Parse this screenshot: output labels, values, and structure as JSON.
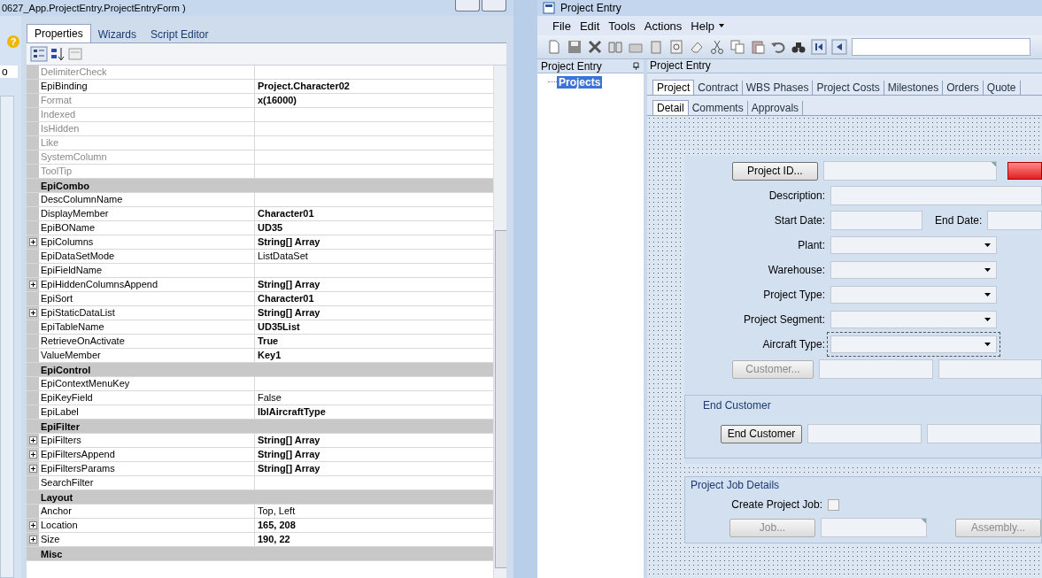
{
  "left_window": {
    "title": "0627_App.ProjectEntry.ProjectEntryForm )",
    "help_glyph": "?",
    "side_label": "o",
    "tabs": [
      {
        "label": "Properties",
        "selected": true
      },
      {
        "label": "Wizards",
        "selected": false
      },
      {
        "label": "Script Editor",
        "selected": false
      }
    ],
    "properties": [
      {
        "kind": "prop",
        "name": "DelimiterCheck",
        "disabled": true,
        "expandable": false
      },
      {
        "kind": "prop",
        "name": "EpiBinding",
        "value": "Project.Character02",
        "disabled": false,
        "bold": true,
        "expandable": false
      },
      {
        "kind": "prop",
        "name": "Format",
        "value": "x(16000)",
        "disabled": true,
        "bold": true,
        "expandable": false
      },
      {
        "kind": "prop",
        "name": "Indexed",
        "disabled": true,
        "expandable": false
      },
      {
        "kind": "prop",
        "name": "IsHidden",
        "disabled": true,
        "expandable": false
      },
      {
        "kind": "prop",
        "name": "Like",
        "disabled": true,
        "expandable": false
      },
      {
        "kind": "prop",
        "name": "SystemColumn",
        "disabled": true,
        "expandable": false
      },
      {
        "kind": "prop",
        "name": "ToolTip",
        "disabled": true,
        "expandable": false
      },
      {
        "kind": "category",
        "name": "EpiCombo"
      },
      {
        "kind": "prop",
        "name": "DescColumnName",
        "disabled": false,
        "expandable": false
      },
      {
        "kind": "prop",
        "name": "DisplayMember",
        "value": "Character01",
        "disabled": false,
        "bold": true,
        "expandable": false
      },
      {
        "kind": "prop",
        "name": "EpiBOName",
        "value": "UD35",
        "disabled": false,
        "bold": true,
        "expandable": false
      },
      {
        "kind": "prop",
        "name": "EpiColumns",
        "value": "String[] Array",
        "disabled": false,
        "bold": true,
        "expandable": true
      },
      {
        "kind": "prop",
        "name": "EpiDataSetMode",
        "value": "ListDataSet",
        "disabled": false,
        "bold": false,
        "expandable": false
      },
      {
        "kind": "prop",
        "name": "EpiFieldName",
        "disabled": false,
        "expandable": false
      },
      {
        "kind": "prop",
        "name": "EpiHiddenColumnsAppend",
        "value": "String[] Array",
        "disabled": false,
        "bold": true,
        "expandable": true
      },
      {
        "kind": "prop",
        "name": "EpiSort",
        "value": "Character01",
        "disabled": false,
        "bold": true,
        "expandable": false
      },
      {
        "kind": "prop",
        "name": "EpiStaticDataList",
        "value": "String[] Array",
        "disabled": false,
        "bold": true,
        "expandable": true
      },
      {
        "kind": "prop",
        "name": "EpiTableName",
        "value": "UD35List",
        "disabled": false,
        "bold": true,
        "expandable": false
      },
      {
        "kind": "prop",
        "name": "RetrieveOnActivate",
        "value": "True",
        "disabled": false,
        "bold": true,
        "expandable": false
      },
      {
        "kind": "prop",
        "name": "ValueMember",
        "value": "Key1",
        "disabled": false,
        "bold": true,
        "expandable": false
      },
      {
        "kind": "category",
        "name": "EpiControl"
      },
      {
        "kind": "prop",
        "name": "EpiContextMenuKey",
        "disabled": false,
        "expandable": false
      },
      {
        "kind": "prop",
        "name": "EpiKeyField",
        "value": "False",
        "disabled": false,
        "bold": false,
        "expandable": false
      },
      {
        "kind": "prop",
        "name": "EpiLabel",
        "value": "lblAircraftType",
        "disabled": false,
        "bold": true,
        "expandable": false
      },
      {
        "kind": "category",
        "name": "EpiFilter"
      },
      {
        "kind": "prop",
        "name": "EpiFilters",
        "value": "String[] Array",
        "disabled": false,
        "bold": true,
        "expandable": true
      },
      {
        "kind": "prop",
        "name": "EpiFiltersAppend",
        "value": "String[] Array",
        "disabled": false,
        "bold": true,
        "expandable": true
      },
      {
        "kind": "prop",
        "name": "EpiFiltersParams",
        "value": "String[] Array",
        "disabled": false,
        "bold": true,
        "expandable": true
      },
      {
        "kind": "prop",
        "name": "SearchFilter",
        "disabled": false,
        "expandable": false
      },
      {
        "kind": "category",
        "name": "Layout"
      },
      {
        "kind": "prop",
        "name": "Anchor",
        "value": "Top, Left",
        "disabled": false,
        "bold": false,
        "expandable": false
      },
      {
        "kind": "prop",
        "name": "Location",
        "value": "165, 208",
        "disabled": false,
        "bold": true,
        "expandable": true
      },
      {
        "kind": "prop",
        "name": "Size",
        "value": "190, 22",
        "disabled": false,
        "bold": true,
        "expandable": true
      },
      {
        "kind": "category",
        "name": "Misc"
      }
    ]
  },
  "right_window": {
    "title": "Project Entry",
    "menu": [
      "File",
      "Edit",
      "Tools",
      "Actions",
      "Help"
    ],
    "tree_title": "Project Entry",
    "tree_items": [
      {
        "label": "Projects",
        "selected": true
      }
    ],
    "panel_title": "Project Entry",
    "tabs": [
      {
        "label": "Project",
        "selected": true
      },
      {
        "label": "Contract",
        "selected": false
      },
      {
        "label": "WBS Phases",
        "selected": false
      },
      {
        "label": "Project Costs",
        "selected": false
      },
      {
        "label": "Milestones",
        "selected": false
      },
      {
        "label": "Orders",
        "selected": false
      },
      {
        "label": "Quote",
        "selected": false
      }
    ],
    "subtabs": [
      {
        "label": "Detail",
        "selected": true
      },
      {
        "label": "Comments",
        "selected": false
      },
      {
        "label": "Approvals",
        "selected": false
      }
    ],
    "form": {
      "project_id_button": "Project ID...",
      "description": "Description:",
      "start_date": "Start Date:",
      "end_date": "End Date:",
      "plant": "Plant:",
      "warehouse": "Warehouse:",
      "project_type": "Project Type:",
      "project_segment": "Project Segment:",
      "aircraft_type": "Aircraft Type:",
      "customer_button": "Customer...",
      "end_customer_group": "End Customer",
      "end_customer_button": "End Customer",
      "job_group": "Project Job Details",
      "create_job": "Create Project Job:",
      "create_job_checked": false,
      "job_button": "Job...",
      "assembly_button": "Assembly..."
    }
  }
}
